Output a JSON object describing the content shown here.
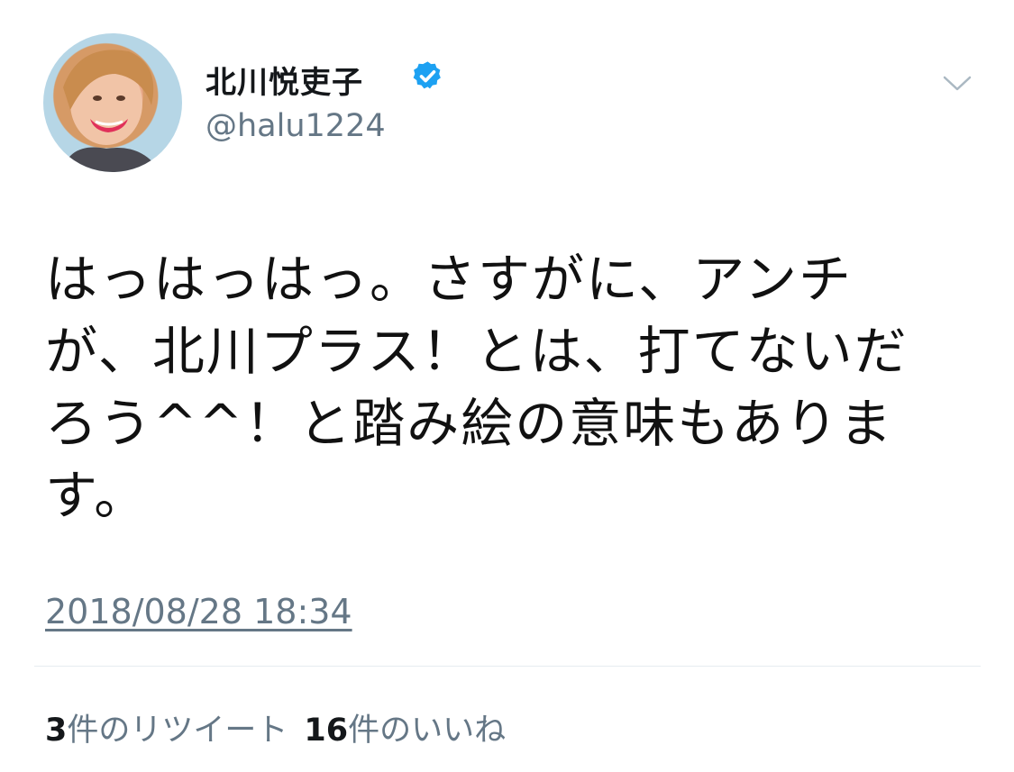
{
  "user": {
    "display_name": "北川悦吏子",
    "handle": "@halu1224",
    "verified": true
  },
  "tweet": {
    "text": "はっはっはっ。さすがに、アンチが、北川プラス！とは、打てないだろう^^！と踏み絵の意味もあります。",
    "timestamp": "2018/08/28 18:34"
  },
  "stats": {
    "retweets_count": "3",
    "retweets_label": "件のリツイート",
    "likes_count": "16",
    "likes_label": "件のいいね"
  },
  "icons": {
    "verified": "verified-badge-icon",
    "menu": "chevron-down-icon"
  },
  "colors": {
    "verified_blue": "#1da1f2",
    "secondary_text": "#657786",
    "divider": "#e6ecf0"
  }
}
